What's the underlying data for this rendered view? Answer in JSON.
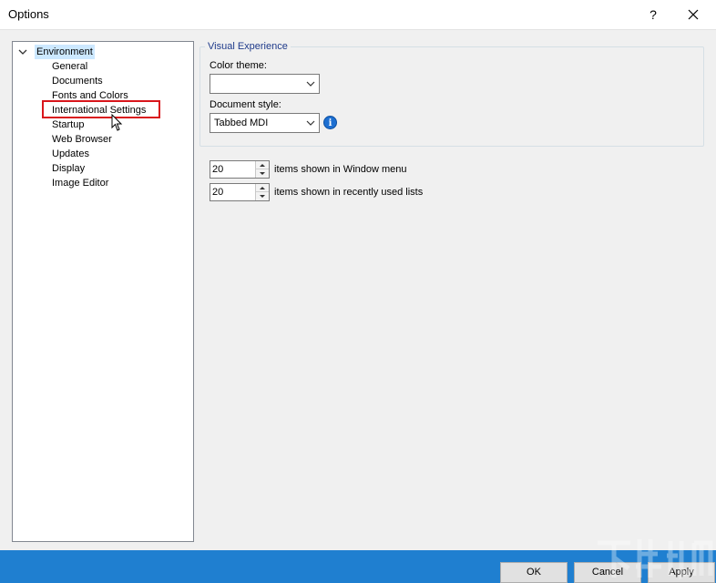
{
  "window": {
    "title": "Options",
    "help_glyph": "?"
  },
  "tree": {
    "root_label": "Environment",
    "items": [
      "General",
      "Documents",
      "Fonts and Colors",
      "International Settings",
      "Startup",
      "Web Browser",
      "Updates",
      "Display",
      "Image Editor"
    ],
    "highlighted_item": "International Settings"
  },
  "visual_experience": {
    "legend": "Visual Experience",
    "color_theme_label": "Color theme:",
    "color_theme_value": "",
    "document_style_label": "Document style:",
    "document_style_value": "Tabbed MDI",
    "info_glyph": "i"
  },
  "counts": {
    "window_menu_value": "20",
    "window_menu_text": "items shown in Window menu",
    "recent_lists_value": "20",
    "recent_lists_text": "items shown in recently used lists"
  },
  "buttons": {
    "ok": "OK",
    "cancel": "Cancel",
    "apply": "Apply"
  },
  "colors": {
    "selection": "#cce8ff",
    "highlight_border": "#d9161c",
    "bottom_bar": "#1f7fd0",
    "legend_text": "#1e3a8a"
  },
  "icons": [
    "close-icon",
    "chevron-down-icon",
    "info-icon",
    "spin-up-icon",
    "spin-down-icon",
    "cursor-icon"
  ]
}
